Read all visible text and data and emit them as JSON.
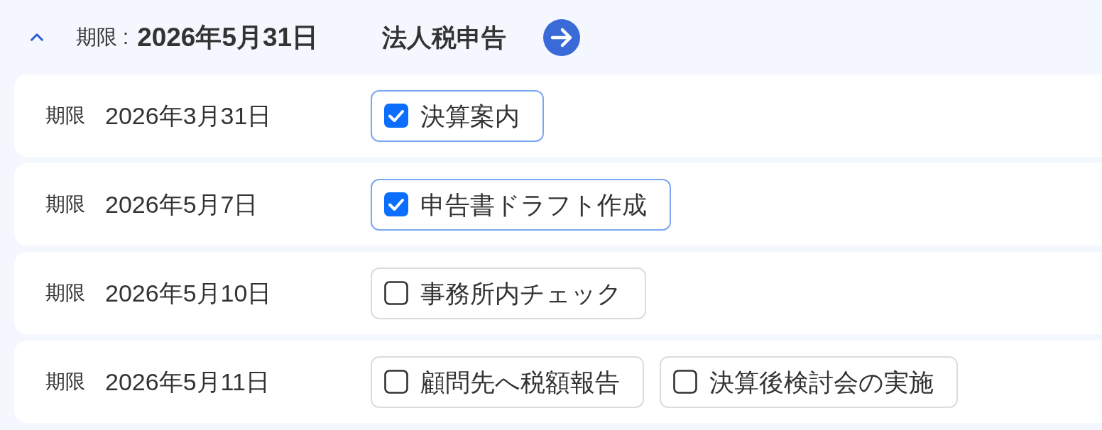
{
  "header": {
    "expanded": true,
    "deadline_label": "期限 :",
    "deadline": "2026年5月31日",
    "title": "法人税申告"
  },
  "rows": [
    {
      "deadline_label": "期限",
      "deadline": "2026年3月31日",
      "tasks": [
        {
          "label": "決算案内",
          "checked": true
        }
      ]
    },
    {
      "deadline_label": "期限",
      "deadline": "2026年5月7日",
      "tasks": [
        {
          "label": "申告書ドラフト作成",
          "checked": true
        }
      ]
    },
    {
      "deadline_label": "期限",
      "deadline": "2026年5月10日",
      "tasks": [
        {
          "label": "事務所内チェック",
          "checked": false
        }
      ]
    },
    {
      "deadline_label": "期限",
      "deadline": "2026年5月11日",
      "tasks": [
        {
          "label": "顧問先へ税額報告",
          "checked": false
        },
        {
          "label": "決算後検討会の実施",
          "checked": false
        }
      ]
    }
  ]
}
